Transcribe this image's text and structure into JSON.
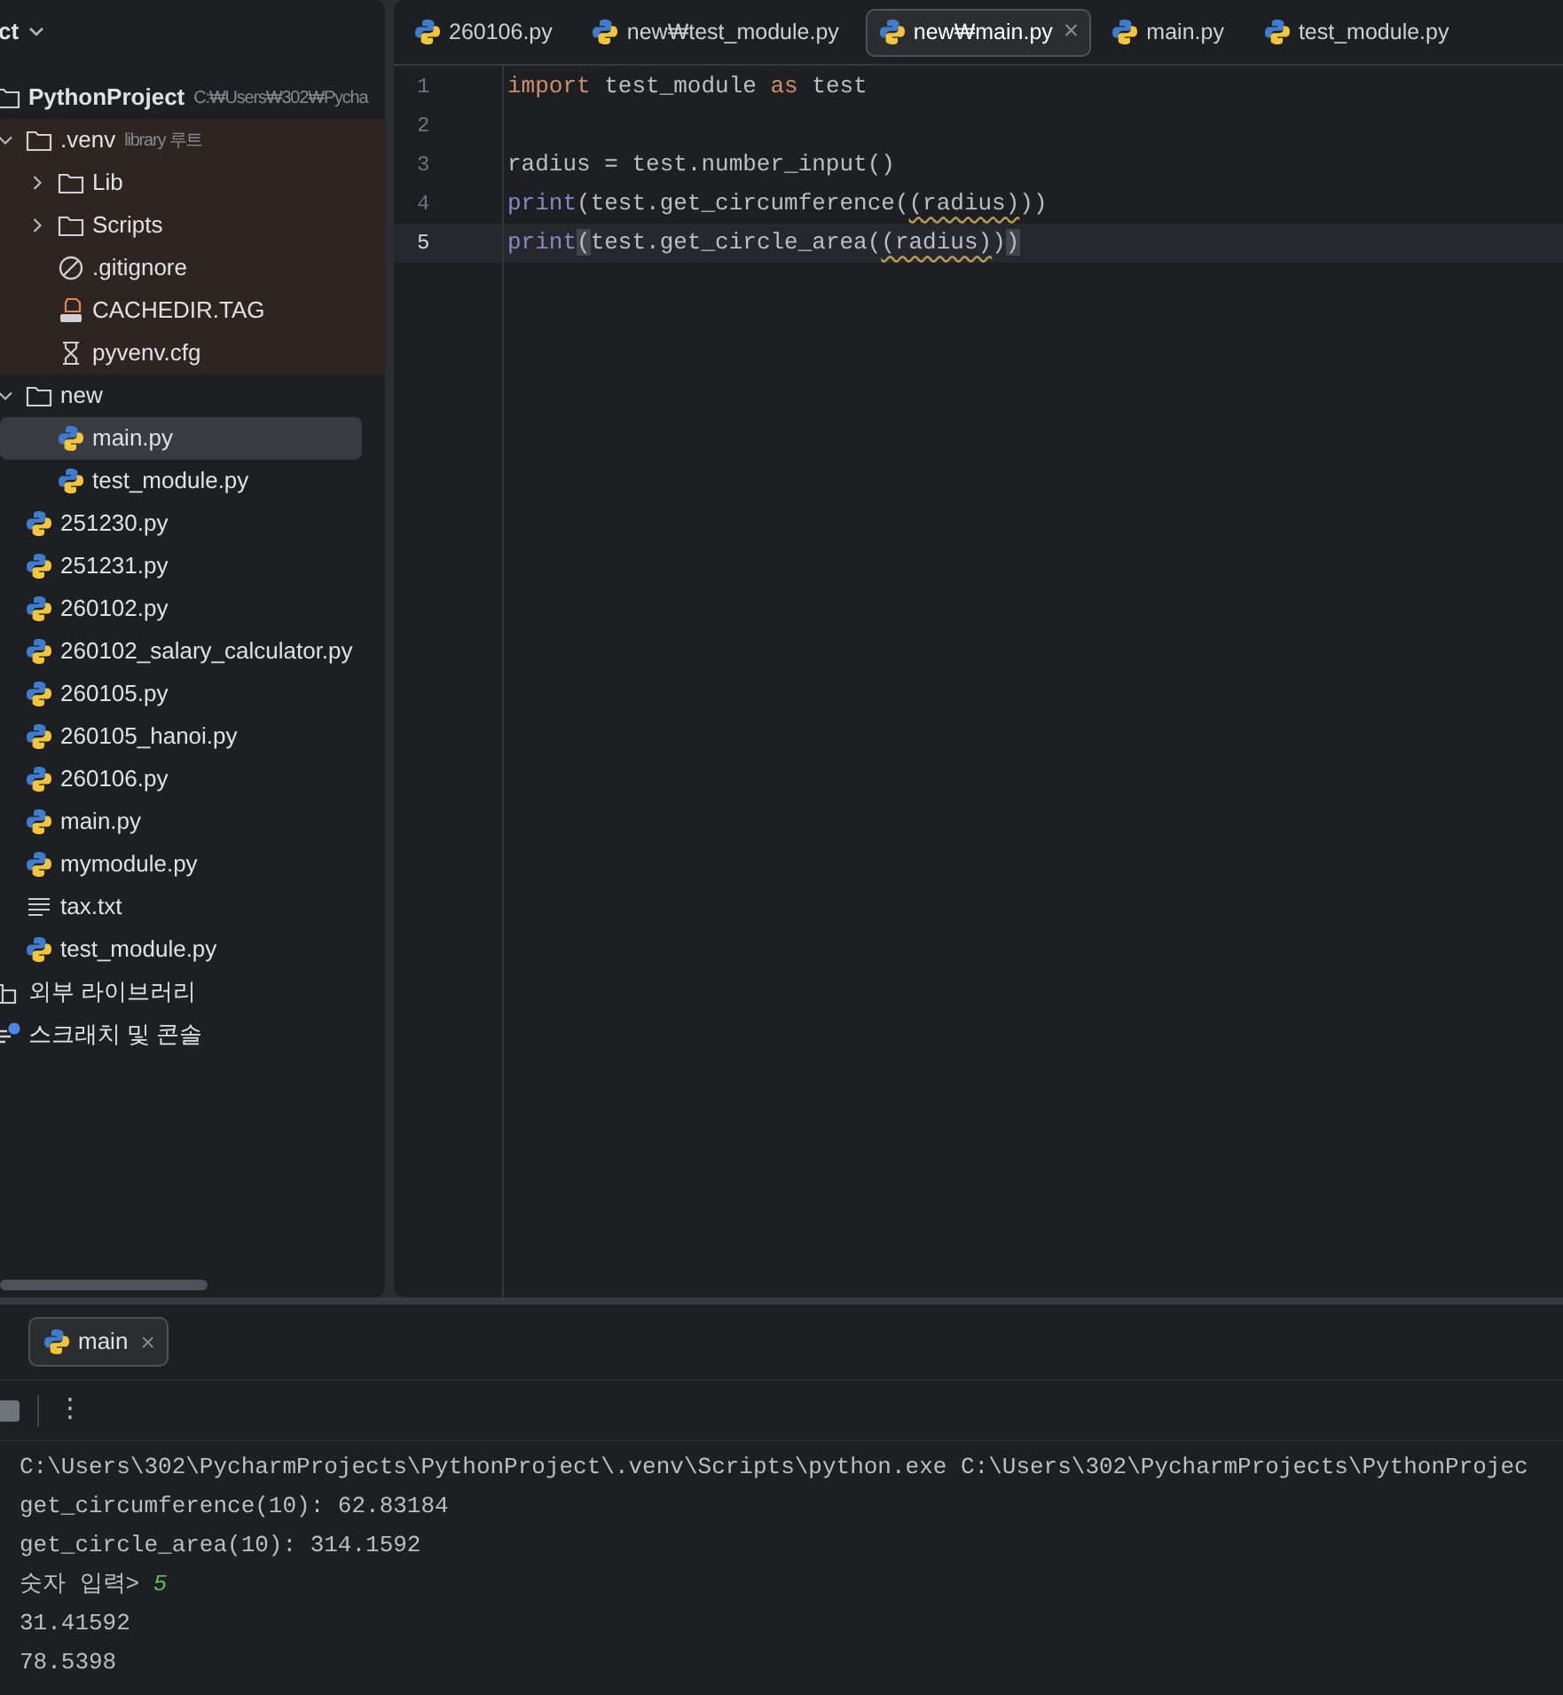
{
  "project_panel": {
    "title": "ct",
    "tree": [
      {
        "kind": "folder",
        "label": "PythonProject",
        "note": "C:₩Users₩302₩Pycha",
        "bold": true,
        "expanded": true,
        "children": [
          {
            "kind": "folder",
            "label": ".venv",
            "note": "library 루트",
            "excluded": true,
            "expanded": true,
            "children": [
              {
                "kind": "folder",
                "label": "Lib",
                "expanded": false
              },
              {
                "kind": "folder",
                "label": "Scripts",
                "expanded": false
              },
              {
                "kind": "ignore",
                "label": ".gitignore"
              },
              {
                "kind": "jsp",
                "label": "CACHEDIR.TAG"
              },
              {
                "kind": "cfg",
                "label": "pyvenv.cfg"
              }
            ]
          },
          {
            "kind": "folder",
            "label": "new",
            "expanded": true,
            "children": [
              {
                "kind": "python",
                "label": "main.py",
                "selected": true
              },
              {
                "kind": "python",
                "label": "test_module.py",
                "selected": false
              }
            ]
          },
          {
            "kind": "python",
            "label": "251230.py",
            "selected": false
          },
          {
            "kind": "python",
            "label": "251231.py",
            "selected": false
          },
          {
            "kind": "python",
            "label": "260102.py",
            "selected": false
          },
          {
            "kind": "python",
            "label": "260102_salary_calculator.py",
            "selected": false
          },
          {
            "kind": "python",
            "label": "260105.py",
            "selected": false
          },
          {
            "kind": "python",
            "label": "260105_hanoi.py",
            "selected": false
          },
          {
            "kind": "python",
            "label": "260106.py",
            "selected": false
          },
          {
            "kind": "python",
            "label": "main.py",
            "selected": false
          },
          {
            "kind": "python",
            "label": "mymodule.py",
            "selected": false
          },
          {
            "kind": "text",
            "label": "tax.txt"
          },
          {
            "kind": "python",
            "label": "test_module.py",
            "selected": false
          }
        ]
      },
      {
        "kind": "library",
        "label": "외부 라이브러리"
      },
      {
        "kind": "scratch",
        "label": "스크래치 및 콘솔"
      }
    ]
  },
  "tabs": [
    {
      "label": "260106.py",
      "selected": false
    },
    {
      "label": "new₩test_module.py",
      "selected": false
    },
    {
      "label": "new₩main.py",
      "selected": true,
      "close": "×"
    },
    {
      "label": "main.py",
      "selected": false
    },
    {
      "label": "test_module.py",
      "selected": false
    }
  ],
  "editor": {
    "lines": [
      {
        "number": "1",
        "current": false,
        "tokens": [
          {
            "kind": "keyword",
            "text": "import"
          },
          {
            "kind": "plain",
            "text": " test_module "
          },
          {
            "kind": "keyword",
            "text": "as"
          },
          {
            "kind": "plain",
            "text": " test"
          }
        ]
      },
      {
        "number": "2",
        "current": false
      },
      {
        "number": "3",
        "current": false,
        "tokens": [
          {
            "kind": "plain",
            "text": "radius = test.number_input()"
          }
        ]
      },
      {
        "number": "4",
        "current": false,
        "tokens": [
          {
            "kind": "builtin",
            "text": "print"
          },
          {
            "kind": "plain",
            "text": "(test.get_circumference("
          },
          {
            "kind": "warn",
            "text": "(radius)"
          },
          {
            "kind": "plain",
            "text": "))"
          }
        ]
      },
      {
        "number": "5",
        "current": true,
        "tokens": [
          {
            "kind": "builtin",
            "text": "print"
          },
          {
            "kind": "brace",
            "text": "("
          },
          {
            "kind": "plain",
            "text": "test.get_circle_area("
          },
          {
            "kind": "warn",
            "text": "(radius)"
          },
          {
            "kind": "plain",
            "text": ")"
          },
          {
            "kind": "brace",
            "text": ")"
          }
        ]
      }
    ]
  },
  "run_panel": {
    "tab": {
      "label": "main",
      "close": "×"
    },
    "menu": "⋮",
    "console": [
      {
        "tokens": [
          {
            "kind": "output",
            "text": "C:\\Users\\302\\PycharmProjects\\PythonProject\\.venv\\Scripts\\python.exe C:\\Users\\302\\PycharmProjects\\PythonProjec"
          }
        ]
      },
      {
        "tokens": [
          {
            "kind": "output",
            "text": "get_circumference(10): 62.83184"
          }
        ]
      },
      {
        "tokens": [
          {
            "kind": "output",
            "text": "get_circle_area(10): 314.1592"
          }
        ]
      },
      {
        "tokens": [
          {
            "kind": "output",
            "text": "숫자 입력> "
          },
          {
            "kind": "input",
            "text": "5"
          }
        ]
      },
      {
        "tokens": [
          {
            "kind": "output",
            "text": "31.41592"
          }
        ]
      },
      {
        "tokens": [
          {
            "kind": "output",
            "text": "78.5398"
          }
        ]
      }
    ]
  }
}
